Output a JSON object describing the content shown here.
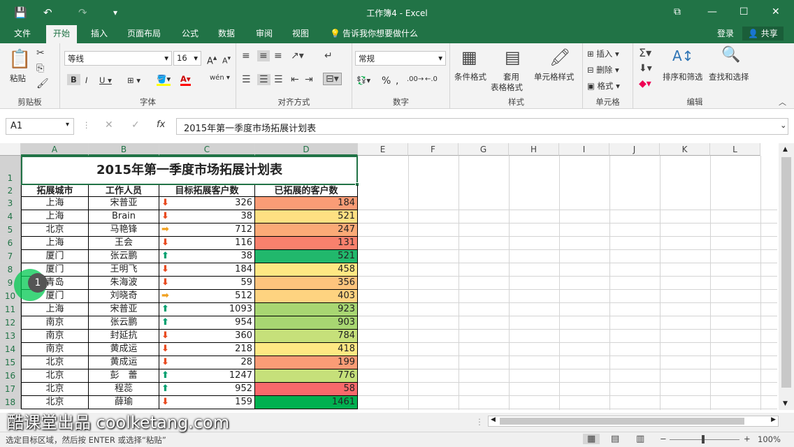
{
  "window": {
    "title": "工作簿4 - Excel"
  },
  "titlebar_icons": {
    "save": "💾",
    "undo": "↶",
    "redo": "↷",
    "customize": "▾",
    "ribbon_options": "⧉",
    "minimize": "—",
    "maximize": "☐",
    "close": "✕"
  },
  "menu": {
    "tabs": [
      "文件",
      "开始",
      "插入",
      "页面布局",
      "公式",
      "数据",
      "审阅",
      "视图"
    ],
    "tell_me": "告诉我你想要做什么",
    "login": "登录",
    "share": "共享"
  },
  "ribbon": {
    "clipboard": {
      "label": "剪贴板",
      "paste": "粘贴"
    },
    "font": {
      "label": "字体",
      "name": "等线",
      "size": "16"
    },
    "alignment": {
      "label": "对齐方式"
    },
    "number": {
      "label": "数字",
      "format": "常规"
    },
    "styles": {
      "label": "样式",
      "conditional": "条件格式",
      "table1": "套用",
      "table2": "表格格式",
      "cell_style": "单元格样式"
    },
    "cells": {
      "label": "单元格",
      "insert": "插入",
      "delete": "删除",
      "format": "格式"
    },
    "editing": {
      "label": "编辑",
      "sort": "排序和筛选",
      "find": "查找和选择"
    }
  },
  "formula": {
    "name_box": "A1",
    "content": "2015年第一季度市场拓展计划表"
  },
  "columns": [
    "A",
    "B",
    "C",
    "D",
    "E",
    "F",
    "G",
    "H",
    "I",
    "J",
    "K",
    "L"
  ],
  "sheet": {
    "title": "2015年第一季度市场拓展计划表",
    "headers": [
      "拓展城市",
      "工作人员",
      "目标拓展客户数",
      "已拓展的客户数"
    ],
    "rows": [
      {
        "row": "3",
        "city": "上海",
        "person": "宋普亚",
        "target": "326",
        "trend": "down",
        "done": "184",
        "color": "#fa9c76"
      },
      {
        "row": "4",
        "city": "上海",
        "person": "Brain",
        "target": "38",
        "trend": "down",
        "done": "521",
        "color": "#fee082"
      },
      {
        "row": "5",
        "city": "北京",
        "person": "马艳锋",
        "target": "712",
        "trend": "right",
        "done": "247",
        "color": "#fbaa77"
      },
      {
        "row": "6",
        "city": "上海",
        "person": "王会",
        "target": "116",
        "trend": "down",
        "done": "131",
        "color": "#f8816d"
      },
      {
        "row": "7",
        "city": "厦门",
        "person": "张云鹏",
        "target": "38",
        "trend": "up",
        "done": "521",
        "color": "#21b86c"
      },
      {
        "row": "8",
        "city": "厦门",
        "person": "王明飞",
        "target": "184",
        "trend": "down",
        "done": "458",
        "color": "#fee883"
      },
      {
        "row": "9",
        "city": "青岛",
        "person": "朱海波",
        "target": "59",
        "trend": "down",
        "done": "356",
        "color": "#fdc47d"
      },
      {
        "row": "10",
        "city": "厦门",
        "person": "刘晓奇",
        "target": "512",
        "trend": "right",
        "done": "403",
        "color": "#fed380"
      },
      {
        "row": "11",
        "city": "上海",
        "person": "宋普亚",
        "target": "1093",
        "trend": "up",
        "done": "923",
        "color": "#a8d672"
      },
      {
        "row": "12",
        "city": "南京",
        "person": "张云鹏",
        "target": "954",
        "trend": "up",
        "done": "903",
        "color": "#a8d672"
      },
      {
        "row": "13",
        "city": "南京",
        "person": "封延抗",
        "target": "360",
        "trend": "down",
        "done": "784",
        "color": "#c6e07a"
      },
      {
        "row": "14",
        "city": "南京",
        "person": "黄成运",
        "target": "218",
        "trend": "down",
        "done": "418",
        "color": "#fee883"
      },
      {
        "row": "15",
        "city": "北京",
        "person": "黄成运",
        "target": "28",
        "trend": "down",
        "done": "199",
        "color": "#fa9c76"
      },
      {
        "row": "16",
        "city": "北京",
        "person": "彭　蕾",
        "target": "1247",
        "trend": "up",
        "done": "776",
        "color": "#c6e07a"
      },
      {
        "row": "17",
        "city": "北京",
        "person": "程蕊",
        "target": "952",
        "trend": "up",
        "done": "58",
        "color": "#f8696b"
      },
      {
        "row": "18",
        "city": "北京",
        "person": "薛瑜",
        "target": "159",
        "trend": "down",
        "done": "1461",
        "color": "#00b050"
      }
    ]
  },
  "status": {
    "text": "选定目标区域，然后按 ENTER 或选择“粘贴”",
    "zoom": "100%"
  },
  "step_badge": "1",
  "watermark": "酷课堂出品 coolketang.com"
}
